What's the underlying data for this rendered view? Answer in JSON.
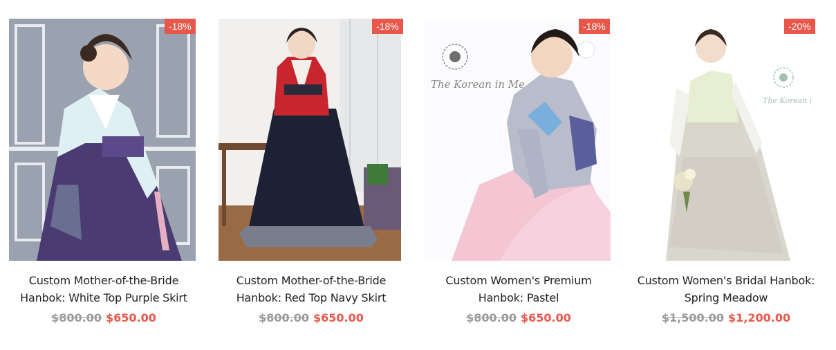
{
  "products": [
    {
      "badge": "-18%",
      "title_line1": "Custom Mother-of-the-Bride",
      "title_line2": "Hanbok: White Top Purple Skirt",
      "old_price": "$800.00",
      "new_price": "$650.00"
    },
    {
      "badge": "-18%",
      "title_line1": "Custom Mother-of-the-Bride",
      "title_line2": "Hanbok: Red Top Navy Skirt",
      "old_price": "$800.00",
      "new_price": "$650.00"
    },
    {
      "badge": "-18%",
      "title_line1": "Custom Women's Premium",
      "title_line2": "Hanbok: Pastel",
      "old_price": "$800.00",
      "new_price": "$650.00",
      "watermark_text": "The Korean in Me"
    },
    {
      "badge": "-20%",
      "title_line1": "Custom Women's Bridal Hanbok:",
      "title_line2": "Spring Meadow",
      "old_price": "$1,500.00",
      "new_price": "$1,200.00",
      "watermark_text": "The Korean in Me"
    }
  ],
  "colors": {
    "sale_badge": "#e8574a",
    "sale_price": "#e8574a",
    "old_price": "#9a9a9a"
  }
}
